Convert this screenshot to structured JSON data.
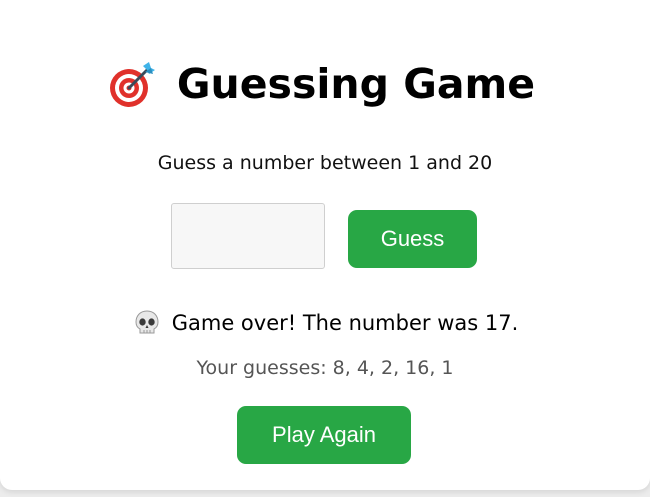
{
  "game": {
    "title": "Guessing Game",
    "title_icon": "direct-hit-target-icon",
    "instructions": "Guess a number between 1 and 20",
    "input_value": "",
    "guess_button_label": "Guess",
    "result_icon": "skull-icon",
    "result_message": "Game over! The number was 17.",
    "guesses_label": "Your guesses: 8, 4, 2, 16, 1",
    "play_again_label": "Play Again"
  },
  "colors": {
    "button_green": "#28a745",
    "background": "#ffffff",
    "target_red": "#e0312b"
  }
}
